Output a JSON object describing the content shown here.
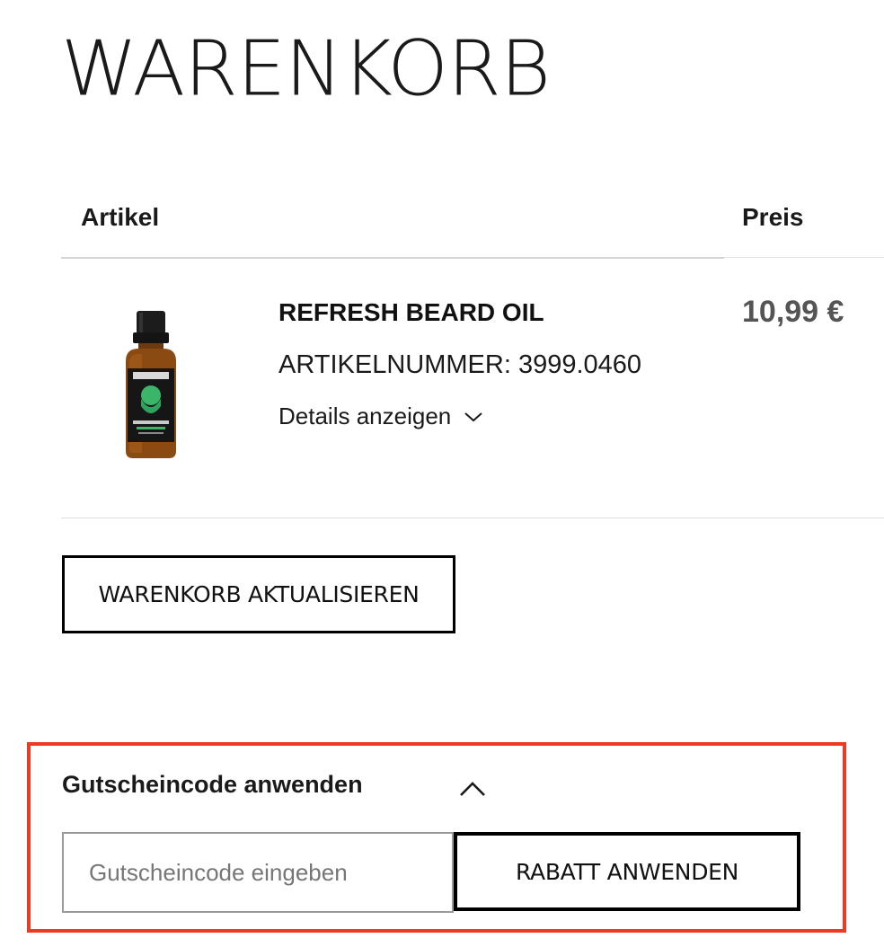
{
  "page": {
    "title": "WARENKORB"
  },
  "cart_table": {
    "columns": {
      "item": "Artikel",
      "price": "Preis"
    },
    "items": [
      {
        "name": "REFRESH BEARD OIL",
        "sku": "ARTIKELNUMMER: 3999.0460",
        "details_label": "Details anzeigen",
        "price": "10,99 €",
        "image_icon": "beard-oil-bottle"
      }
    ]
  },
  "actions": {
    "update_cart_label": "WARENKORB AKTUALISIEREN"
  },
  "coupon": {
    "title": "Gutscheincode anwenden",
    "expanded": true,
    "input_placeholder": "Gutscheincode eingeben",
    "input_value": "",
    "apply_label": "RABATT ANWENDEN"
  },
  "colors": {
    "highlight_border": "#ee3a22",
    "price_text": "#555555",
    "text": "#1a1a1a"
  }
}
